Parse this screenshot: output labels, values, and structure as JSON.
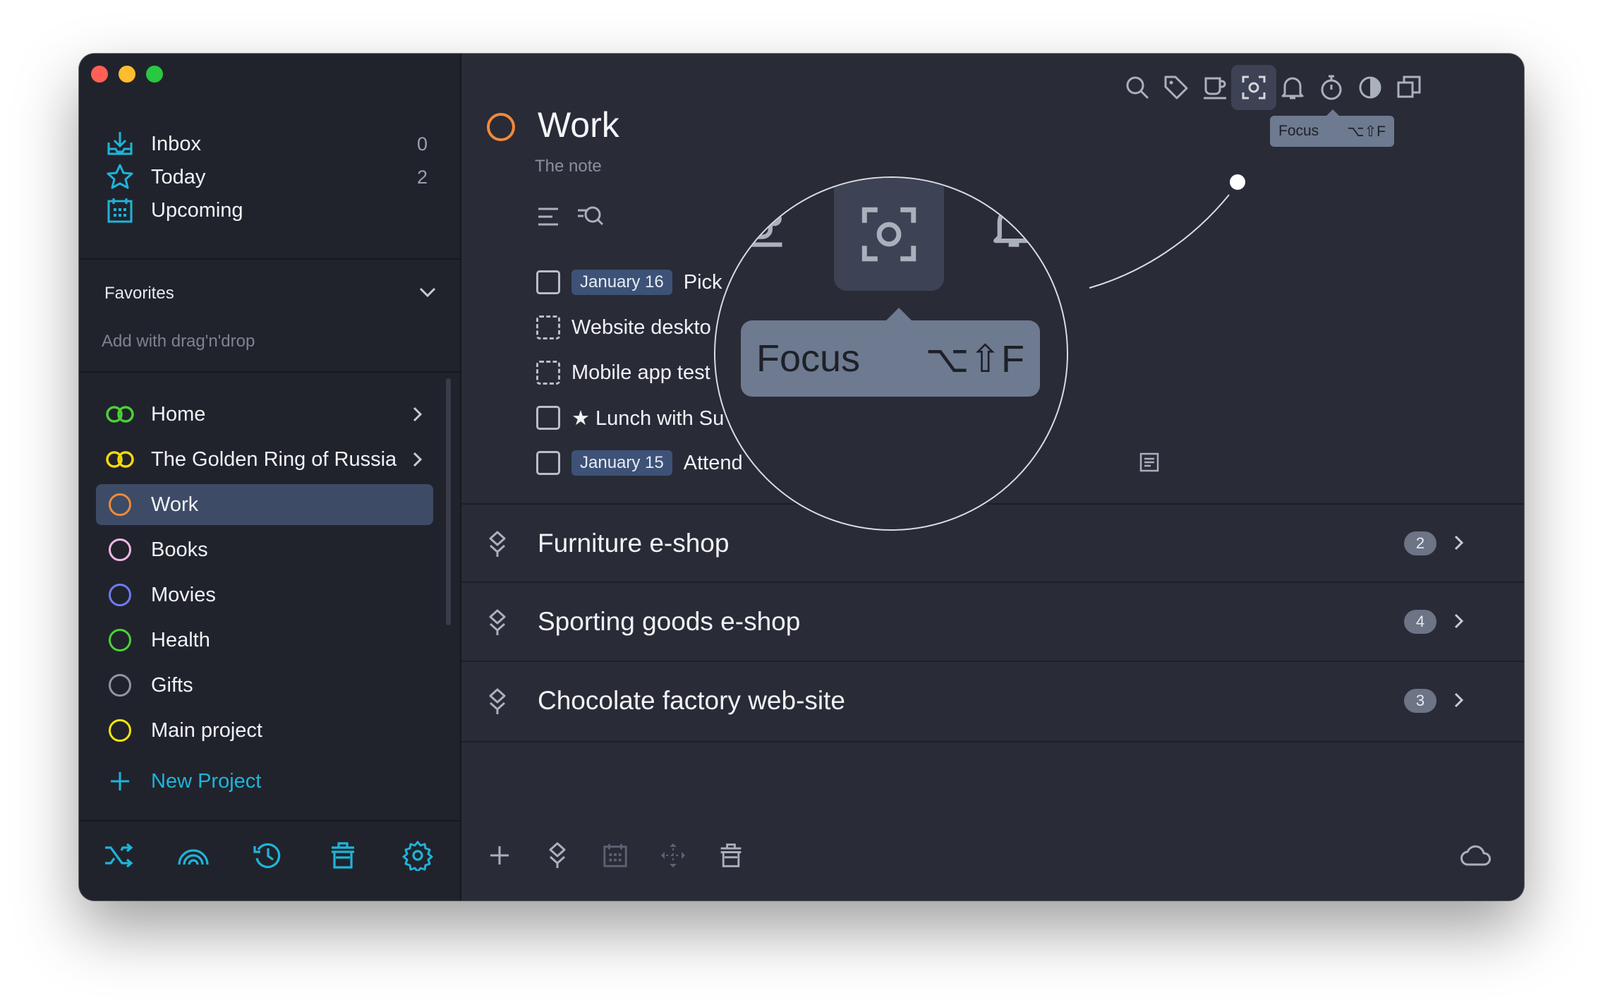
{
  "sidebar": {
    "nav": [
      {
        "label": "Inbox",
        "count": "0",
        "icon": "inbox-icon"
      },
      {
        "label": "Today",
        "count": "2",
        "icon": "star-icon"
      },
      {
        "label": "Upcoming",
        "count": "",
        "icon": "calendar-icon"
      }
    ],
    "favorites": {
      "title": "Favorites",
      "hint": "Add with drag'n'drop"
    },
    "areas": [
      {
        "label": "Home",
        "color": "#4cd137"
      },
      {
        "label": "The Golden Ring of Russia",
        "color": "#f5d90a"
      }
    ],
    "projects": [
      {
        "label": "Work",
        "color": "#f08a3a",
        "selected": true
      },
      {
        "label": "Books",
        "color": "#f2b6e6"
      },
      {
        "label": "Movies",
        "color": "#6e7cf2"
      },
      {
        "label": "Health",
        "color": "#4cd137"
      },
      {
        "label": "Gifts",
        "color": "#8f95a3"
      },
      {
        "label": "Main project",
        "color": "#f5e60a"
      }
    ],
    "new_project": "New Project",
    "bottom_icons": [
      "shuffle-icon",
      "rainbow-icon",
      "history-icon",
      "trash-icon",
      "gear-icon"
    ]
  },
  "toolbar": {
    "icons": [
      "search-icon",
      "tag-icon",
      "coffee-icon",
      "focus-icon",
      "bell-icon",
      "timer-icon",
      "contrast-icon",
      "copy-icon"
    ],
    "tooltip": {
      "label": "Focus",
      "shortcut": "⌥⇧F"
    }
  },
  "project": {
    "title": "Work",
    "note": "The note",
    "tasks": [
      {
        "date": "January 16",
        "text": "Pick",
        "style": "solid"
      },
      {
        "date": "",
        "text": "Website deskto",
        "style": "dashed"
      },
      {
        "date": "",
        "text": "Mobile app test",
        "style": "dashed"
      },
      {
        "date": "",
        "text": "★  Lunch with Su",
        "style": "solid"
      },
      {
        "date": "January 15",
        "text": "Attend",
        "style": "solid"
      }
    ],
    "headings": [
      {
        "title": "Furniture e-shop",
        "count": "2"
      },
      {
        "title": "Sporting goods e-shop",
        "count": "4"
      },
      {
        "title": "Chocolate factory web-site",
        "count": "3"
      }
    ]
  },
  "magnifier": {
    "tooltip_label": "Focus",
    "tooltip_shortcut": "⌥⇧F"
  },
  "colors": {
    "accent": "#1fb4d9",
    "selection": "#3d4b66",
    "badge": "#6c7485",
    "date_tag": "#3d5276"
  }
}
